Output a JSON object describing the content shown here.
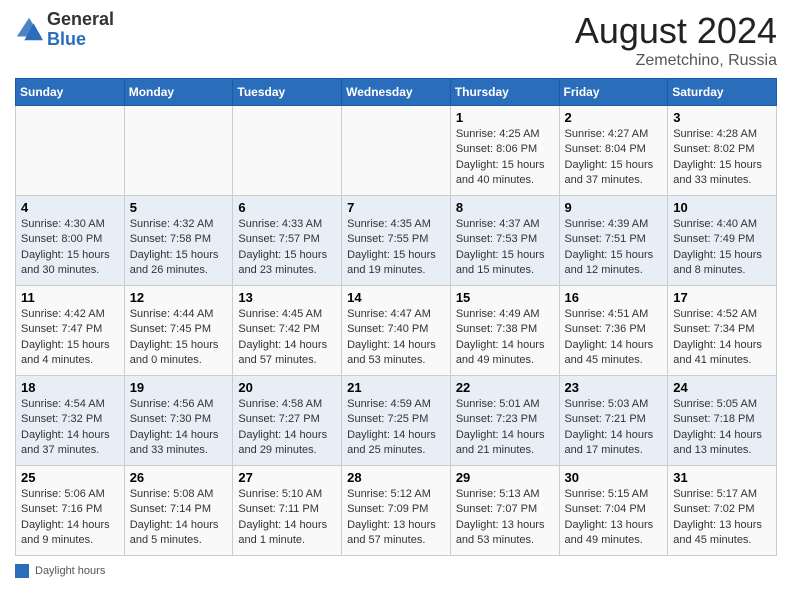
{
  "header": {
    "logo_general": "General",
    "logo_blue": "Blue",
    "month_year": "August 2024",
    "location": "Zemetchino, Russia"
  },
  "days_of_week": [
    "Sunday",
    "Monday",
    "Tuesday",
    "Wednesday",
    "Thursday",
    "Friday",
    "Saturday"
  ],
  "legend_label": "Daylight hours",
  "weeks": [
    [
      {
        "day": "",
        "info": ""
      },
      {
        "day": "",
        "info": ""
      },
      {
        "day": "",
        "info": ""
      },
      {
        "day": "",
        "info": ""
      },
      {
        "day": "1",
        "info": "Sunrise: 4:25 AM\nSunset: 8:06 PM\nDaylight: 15 hours\nand 40 minutes."
      },
      {
        "day": "2",
        "info": "Sunrise: 4:27 AM\nSunset: 8:04 PM\nDaylight: 15 hours\nand 37 minutes."
      },
      {
        "day": "3",
        "info": "Sunrise: 4:28 AM\nSunset: 8:02 PM\nDaylight: 15 hours\nand 33 minutes."
      }
    ],
    [
      {
        "day": "4",
        "info": "Sunrise: 4:30 AM\nSunset: 8:00 PM\nDaylight: 15 hours\nand 30 minutes."
      },
      {
        "day": "5",
        "info": "Sunrise: 4:32 AM\nSunset: 7:58 PM\nDaylight: 15 hours\nand 26 minutes."
      },
      {
        "day": "6",
        "info": "Sunrise: 4:33 AM\nSunset: 7:57 PM\nDaylight: 15 hours\nand 23 minutes."
      },
      {
        "day": "7",
        "info": "Sunrise: 4:35 AM\nSunset: 7:55 PM\nDaylight: 15 hours\nand 19 minutes."
      },
      {
        "day": "8",
        "info": "Sunrise: 4:37 AM\nSunset: 7:53 PM\nDaylight: 15 hours\nand 15 minutes."
      },
      {
        "day": "9",
        "info": "Sunrise: 4:39 AM\nSunset: 7:51 PM\nDaylight: 15 hours\nand 12 minutes."
      },
      {
        "day": "10",
        "info": "Sunrise: 4:40 AM\nSunset: 7:49 PM\nDaylight: 15 hours\nand 8 minutes."
      }
    ],
    [
      {
        "day": "11",
        "info": "Sunrise: 4:42 AM\nSunset: 7:47 PM\nDaylight: 15 hours\nand 4 minutes."
      },
      {
        "day": "12",
        "info": "Sunrise: 4:44 AM\nSunset: 7:45 PM\nDaylight: 15 hours\nand 0 minutes."
      },
      {
        "day": "13",
        "info": "Sunrise: 4:45 AM\nSunset: 7:42 PM\nDaylight: 14 hours\nand 57 minutes."
      },
      {
        "day": "14",
        "info": "Sunrise: 4:47 AM\nSunset: 7:40 PM\nDaylight: 14 hours\nand 53 minutes."
      },
      {
        "day": "15",
        "info": "Sunrise: 4:49 AM\nSunset: 7:38 PM\nDaylight: 14 hours\nand 49 minutes."
      },
      {
        "day": "16",
        "info": "Sunrise: 4:51 AM\nSunset: 7:36 PM\nDaylight: 14 hours\nand 45 minutes."
      },
      {
        "day": "17",
        "info": "Sunrise: 4:52 AM\nSunset: 7:34 PM\nDaylight: 14 hours\nand 41 minutes."
      }
    ],
    [
      {
        "day": "18",
        "info": "Sunrise: 4:54 AM\nSunset: 7:32 PM\nDaylight: 14 hours\nand 37 minutes."
      },
      {
        "day": "19",
        "info": "Sunrise: 4:56 AM\nSunset: 7:30 PM\nDaylight: 14 hours\nand 33 minutes."
      },
      {
        "day": "20",
        "info": "Sunrise: 4:58 AM\nSunset: 7:27 PM\nDaylight: 14 hours\nand 29 minutes."
      },
      {
        "day": "21",
        "info": "Sunrise: 4:59 AM\nSunset: 7:25 PM\nDaylight: 14 hours\nand 25 minutes."
      },
      {
        "day": "22",
        "info": "Sunrise: 5:01 AM\nSunset: 7:23 PM\nDaylight: 14 hours\nand 21 minutes."
      },
      {
        "day": "23",
        "info": "Sunrise: 5:03 AM\nSunset: 7:21 PM\nDaylight: 14 hours\nand 17 minutes."
      },
      {
        "day": "24",
        "info": "Sunrise: 5:05 AM\nSunset: 7:18 PM\nDaylight: 14 hours\nand 13 minutes."
      }
    ],
    [
      {
        "day": "25",
        "info": "Sunrise: 5:06 AM\nSunset: 7:16 PM\nDaylight: 14 hours\nand 9 minutes."
      },
      {
        "day": "26",
        "info": "Sunrise: 5:08 AM\nSunset: 7:14 PM\nDaylight: 14 hours\nand 5 minutes."
      },
      {
        "day": "27",
        "info": "Sunrise: 5:10 AM\nSunset: 7:11 PM\nDaylight: 14 hours\nand 1 minute."
      },
      {
        "day": "28",
        "info": "Sunrise: 5:12 AM\nSunset: 7:09 PM\nDaylight: 13 hours\nand 57 minutes."
      },
      {
        "day": "29",
        "info": "Sunrise: 5:13 AM\nSunset: 7:07 PM\nDaylight: 13 hours\nand 53 minutes."
      },
      {
        "day": "30",
        "info": "Sunrise: 5:15 AM\nSunset: 7:04 PM\nDaylight: 13 hours\nand 49 minutes."
      },
      {
        "day": "31",
        "info": "Sunrise: 5:17 AM\nSunset: 7:02 PM\nDaylight: 13 hours\nand 45 minutes."
      }
    ]
  ]
}
